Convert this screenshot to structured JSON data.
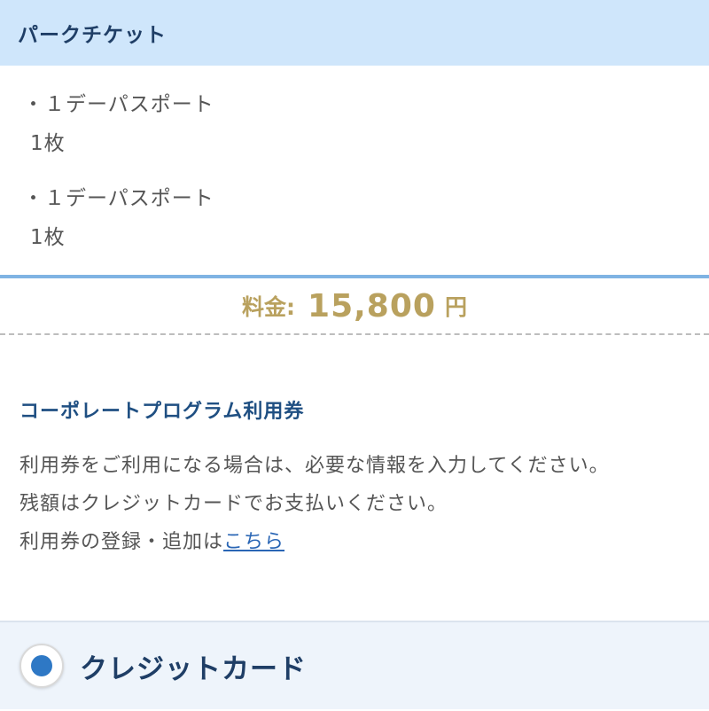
{
  "park_ticket": {
    "title": "パークチケット",
    "items": [
      {
        "name": "・１デーパスポート",
        "qty": "1枚"
      },
      {
        "name": "・１デーパスポート",
        "qty": "1枚"
      }
    ]
  },
  "price": {
    "label": "料金:",
    "amount": "15,800",
    "unit": "円"
  },
  "coupon": {
    "heading": "コーポレートプログラム利用券",
    "line1": "利用券をご利用になる場合は、必要な情報を入力してください。",
    "line2": "残額はクレジットカードでお支払いください。",
    "line3_prefix": "利用券の登録・追加は",
    "line3_link": "こちら"
  },
  "payment": {
    "option_label": "クレジットカード",
    "selected": true
  },
  "colors": {
    "header_bg": "#cfe6fb",
    "accent_gold": "#b9a15e",
    "navy": "#1f3e66",
    "radio_blue": "#2e78c5"
  }
}
